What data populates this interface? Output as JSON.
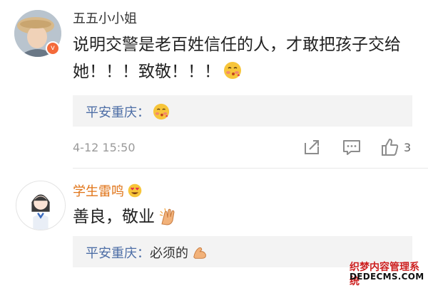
{
  "comments": [
    {
      "username": "五五小小姐",
      "verified_badge": "v",
      "text": "说明交警是老百姓信任的人，才敢把孩子交给她！！！致敬！！！",
      "reply": {
        "user": "平安重庆",
        "separator": "：",
        "text": ""
      },
      "timestamp": "4-12 15:50",
      "likes": "3"
    },
    {
      "username": "学生雷鸣",
      "text": "善良，敬业",
      "reply": {
        "user": "平安重庆",
        "separator": "：",
        "text": "必须的"
      }
    }
  ],
  "icons": [
    "blush-kiss-emoji",
    "heart-eyes-emoji",
    "clap-hands-emoji",
    "flex-arm-emoji",
    "share-icon",
    "comment-icon",
    "thumbs-up-icon"
  ],
  "watermark": {
    "line1": "织梦内容管理系统",
    "line2": "DEDECMS.COM"
  },
  "colors": {
    "username_highlight": "#e07418",
    "reply_user": "#4d6ea6",
    "reply_bg": "#f3f3f3",
    "meta_gray": "#9a9a9a"
  }
}
